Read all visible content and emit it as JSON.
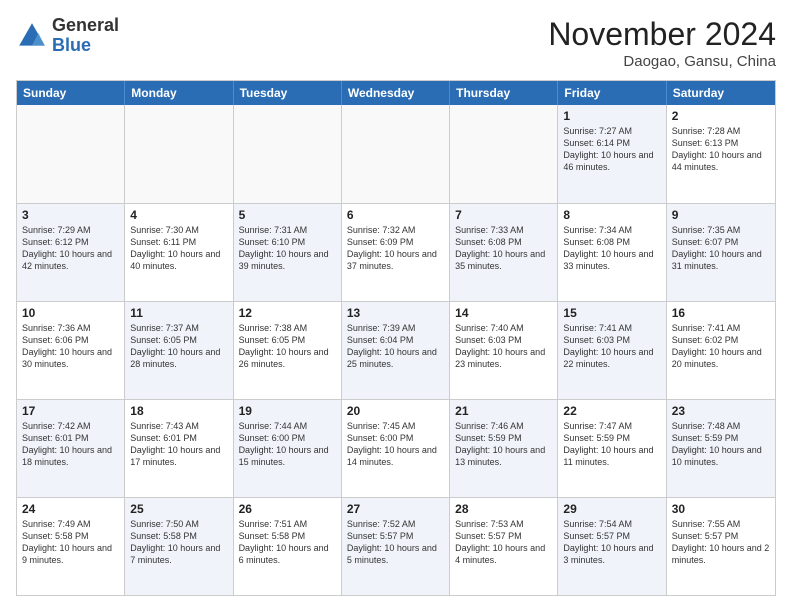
{
  "logo": {
    "general": "General",
    "blue": "Blue"
  },
  "title": "November 2024",
  "location": "Daogao, Gansu, China",
  "days_of_week": [
    "Sunday",
    "Monday",
    "Tuesday",
    "Wednesday",
    "Thursday",
    "Friday",
    "Saturday"
  ],
  "weeks": [
    [
      {
        "day": "",
        "text": "",
        "empty": true
      },
      {
        "day": "",
        "text": "",
        "empty": true
      },
      {
        "day": "",
        "text": "",
        "empty": true
      },
      {
        "day": "",
        "text": "",
        "empty": true
      },
      {
        "day": "",
        "text": "",
        "empty": true
      },
      {
        "day": "1",
        "text": "Sunrise: 7:27 AM\nSunset: 6:14 PM\nDaylight: 10 hours and 46 minutes.",
        "shaded": true
      },
      {
        "day": "2",
        "text": "Sunrise: 7:28 AM\nSunset: 6:13 PM\nDaylight: 10 hours and 44 minutes.",
        "shaded": false
      }
    ],
    [
      {
        "day": "3",
        "text": "Sunrise: 7:29 AM\nSunset: 6:12 PM\nDaylight: 10 hours and 42 minutes.",
        "shaded": true
      },
      {
        "day": "4",
        "text": "Sunrise: 7:30 AM\nSunset: 6:11 PM\nDaylight: 10 hours and 40 minutes.",
        "shaded": false
      },
      {
        "day": "5",
        "text": "Sunrise: 7:31 AM\nSunset: 6:10 PM\nDaylight: 10 hours and 39 minutes.",
        "shaded": true
      },
      {
        "day": "6",
        "text": "Sunrise: 7:32 AM\nSunset: 6:09 PM\nDaylight: 10 hours and 37 minutes.",
        "shaded": false
      },
      {
        "day": "7",
        "text": "Sunrise: 7:33 AM\nSunset: 6:08 PM\nDaylight: 10 hours and 35 minutes.",
        "shaded": true
      },
      {
        "day": "8",
        "text": "Sunrise: 7:34 AM\nSunset: 6:08 PM\nDaylight: 10 hours and 33 minutes.",
        "shaded": false
      },
      {
        "day": "9",
        "text": "Sunrise: 7:35 AM\nSunset: 6:07 PM\nDaylight: 10 hours and 31 minutes.",
        "shaded": true
      }
    ],
    [
      {
        "day": "10",
        "text": "Sunrise: 7:36 AM\nSunset: 6:06 PM\nDaylight: 10 hours and 30 minutes.",
        "shaded": false
      },
      {
        "day": "11",
        "text": "Sunrise: 7:37 AM\nSunset: 6:05 PM\nDaylight: 10 hours and 28 minutes.",
        "shaded": true
      },
      {
        "day": "12",
        "text": "Sunrise: 7:38 AM\nSunset: 6:05 PM\nDaylight: 10 hours and 26 minutes.",
        "shaded": false
      },
      {
        "day": "13",
        "text": "Sunrise: 7:39 AM\nSunset: 6:04 PM\nDaylight: 10 hours and 25 minutes.",
        "shaded": true
      },
      {
        "day": "14",
        "text": "Sunrise: 7:40 AM\nSunset: 6:03 PM\nDaylight: 10 hours and 23 minutes.",
        "shaded": false
      },
      {
        "day": "15",
        "text": "Sunrise: 7:41 AM\nSunset: 6:03 PM\nDaylight: 10 hours and 22 minutes.",
        "shaded": true
      },
      {
        "day": "16",
        "text": "Sunrise: 7:41 AM\nSunset: 6:02 PM\nDaylight: 10 hours and 20 minutes.",
        "shaded": false
      }
    ],
    [
      {
        "day": "17",
        "text": "Sunrise: 7:42 AM\nSunset: 6:01 PM\nDaylight: 10 hours and 18 minutes.",
        "shaded": true
      },
      {
        "day": "18",
        "text": "Sunrise: 7:43 AM\nSunset: 6:01 PM\nDaylight: 10 hours and 17 minutes.",
        "shaded": false
      },
      {
        "day": "19",
        "text": "Sunrise: 7:44 AM\nSunset: 6:00 PM\nDaylight: 10 hours and 15 minutes.",
        "shaded": true
      },
      {
        "day": "20",
        "text": "Sunrise: 7:45 AM\nSunset: 6:00 PM\nDaylight: 10 hours and 14 minutes.",
        "shaded": false
      },
      {
        "day": "21",
        "text": "Sunrise: 7:46 AM\nSunset: 5:59 PM\nDaylight: 10 hours and 13 minutes.",
        "shaded": true
      },
      {
        "day": "22",
        "text": "Sunrise: 7:47 AM\nSunset: 5:59 PM\nDaylight: 10 hours and 11 minutes.",
        "shaded": false
      },
      {
        "day": "23",
        "text": "Sunrise: 7:48 AM\nSunset: 5:59 PM\nDaylight: 10 hours and 10 minutes.",
        "shaded": true
      }
    ],
    [
      {
        "day": "24",
        "text": "Sunrise: 7:49 AM\nSunset: 5:58 PM\nDaylight: 10 hours and 9 minutes.",
        "shaded": false
      },
      {
        "day": "25",
        "text": "Sunrise: 7:50 AM\nSunset: 5:58 PM\nDaylight: 10 hours and 7 minutes.",
        "shaded": true
      },
      {
        "day": "26",
        "text": "Sunrise: 7:51 AM\nSunset: 5:58 PM\nDaylight: 10 hours and 6 minutes.",
        "shaded": false
      },
      {
        "day": "27",
        "text": "Sunrise: 7:52 AM\nSunset: 5:57 PM\nDaylight: 10 hours and 5 minutes.",
        "shaded": true
      },
      {
        "day": "28",
        "text": "Sunrise: 7:53 AM\nSunset: 5:57 PM\nDaylight: 10 hours and 4 minutes.",
        "shaded": false
      },
      {
        "day": "29",
        "text": "Sunrise: 7:54 AM\nSunset: 5:57 PM\nDaylight: 10 hours and 3 minutes.",
        "shaded": true
      },
      {
        "day": "30",
        "text": "Sunrise: 7:55 AM\nSunset: 5:57 PM\nDaylight: 10 hours and 2 minutes.",
        "shaded": false
      }
    ]
  ]
}
